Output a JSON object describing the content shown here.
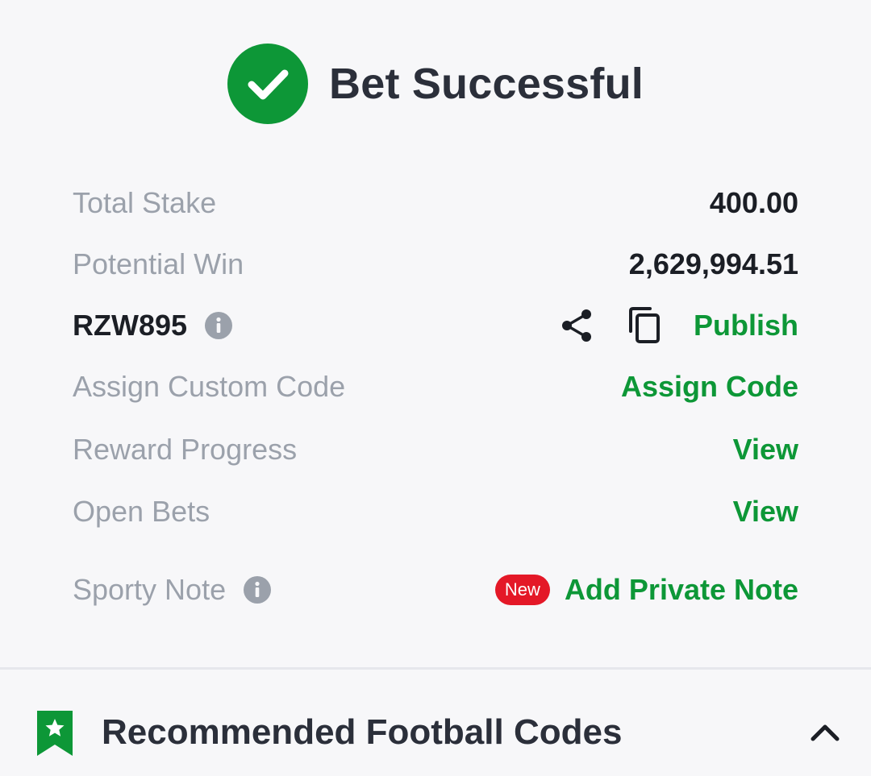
{
  "header": {
    "title": "Bet Successful",
    "icon": "check-circle-icon"
  },
  "summary": {
    "total_stake_label": "Total Stake",
    "total_stake_value": "400.00",
    "potential_win_label": "Potential Win",
    "potential_win_value": "2,629,994.51",
    "booking_code": "RZW895",
    "publish_label": "Publish",
    "assign_custom_code_label": "Assign Custom Code",
    "assign_code_link": "Assign Code",
    "reward_progress_label": "Reward Progress",
    "reward_progress_link": "View",
    "open_bets_label": "Open Bets",
    "open_bets_link": "View",
    "sporty_note_label": "Sporty Note",
    "new_badge": "New",
    "add_private_note_link": "Add Private Note"
  },
  "recommended": {
    "title": "Recommended Football Codes"
  },
  "colors": {
    "accent_green": "#0d9737",
    "badge_red": "#e41827",
    "label_gray": "#9ba1ab",
    "text_dark": "#1b1e25",
    "background": "#f7f7f9"
  }
}
